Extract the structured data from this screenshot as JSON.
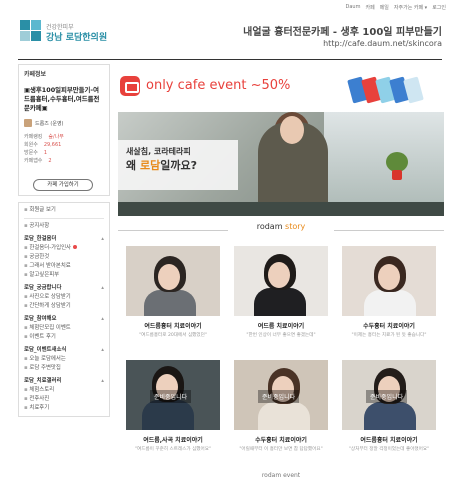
{
  "header": {
    "clinic_sub": "건강한피부",
    "clinic_name": "강남 로담한의원",
    "cafe_title": "내얼굴 흉터전문카페 - 생후 100일 피부만들기",
    "cafe_url": "http://cafe.daum.net/skincora",
    "utils": [
      "Daum",
      "카페",
      "메일",
      "자주가는 카페 ▾",
      "로그인"
    ],
    "accent": "#2a8fa6"
  },
  "sidebar": {
    "info_title": "카페정보",
    "description": "▣생후100일피부만들기-여드름흉터,수두흉터,여드름전문카페▣",
    "member": "드롭즈 (운영)",
    "stats": [
      {
        "label": "카페랭킹",
        "value": "숲/나무"
      },
      {
        "label": "회원수",
        "value": "29,661"
      },
      {
        "label": "방문수",
        "value": "1"
      },
      {
        "label": "카페앱수",
        "value": "2"
      }
    ],
    "join_label": "카페 가입하기",
    "menus": [
      {
        "type": "item",
        "label": "회원글 보기"
      },
      {
        "type": "sep"
      },
      {
        "type": "item",
        "label": "공지사항"
      },
      {
        "type": "group",
        "label": "로담_한걸음더"
      },
      {
        "type": "item",
        "label": "한걸음더-가입인사",
        "new": true
      },
      {
        "type": "item",
        "label": "궁금한것"
      },
      {
        "type": "item",
        "label": "그래서 받아본치료"
      },
      {
        "type": "item",
        "label": "알고싶은피부"
      },
      {
        "type": "group",
        "label": "로담_궁금합니다"
      },
      {
        "type": "item",
        "label": "사진으로 상담받기"
      },
      {
        "type": "item",
        "label": "간단하게 상담받기"
      },
      {
        "type": "group",
        "label": "로담_참여해요"
      },
      {
        "type": "item",
        "label": "체험단모집 이벤트"
      },
      {
        "type": "item",
        "label": "이벤트 후기"
      },
      {
        "type": "group",
        "label": "로담_이벤트새소식"
      },
      {
        "type": "item",
        "label": "오늘 로담에서는"
      },
      {
        "type": "item",
        "label": "로담 주변맛집"
      },
      {
        "type": "group",
        "label": "로담_치료갤러리"
      },
      {
        "type": "item",
        "label": "체험스토리"
      },
      {
        "type": "item",
        "label": "전후사진"
      },
      {
        "type": "item",
        "label": "치료후기"
      }
    ]
  },
  "main": {
    "event_text_prefix": "only cafe",
    "event_text": "event ~50%",
    "hero_line1": "새살침, 코라테라피",
    "hero_line2_a": "왜 ",
    "hero_line2_hl": "로담",
    "hero_line2_b": "일까요?",
    "story_prefix": "rodam",
    "story_word": "story",
    "tiles": [
      {
        "title": "여드름흉터 치료이야기",
        "sub": "\"여드름흉터로 20대에서 심했었던\"",
        "prep": ""
      },
      {
        "title": "여드름 치료이야기",
        "sub": "\"한번 인상이 너무 좋으면 좋겠는데\"",
        "prep": ""
      },
      {
        "title": "수두흉터 치료이야기",
        "sub": "\"이제는 흉터는 치료가 된 듯 좋습니다\"",
        "prep": ""
      },
      {
        "title": "여드름,사곡 치료이야기",
        "sub": "\"여드름이 꾸준히 스트레스가 심했어요\"",
        "prep": "준비중입니다"
      },
      {
        "title": "수두흉터 치료이야기",
        "sub": "\"어릴때부터 이 흉터만 보면 참 답답했어요\"",
        "prep": "준비중입니다"
      },
      {
        "title": "여드름흉터 치료이야기",
        "sub": "\"상처부터 정말 걱정이었는데 좋아졌어요\"",
        "prep": "준비중입니다"
      }
    ],
    "bottom_peek": "rodam event"
  }
}
